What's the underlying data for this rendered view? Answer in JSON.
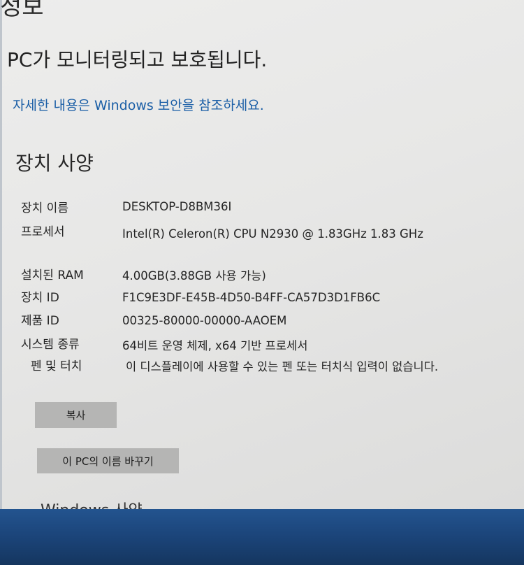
{
  "header": {
    "section_title": "정보"
  },
  "protection": {
    "status_text": "PC가 모니터링되고 보호됩니다.",
    "link_text": "자세한 내용은 Windows 보안을 참조하세요."
  },
  "device_specs": {
    "title": "장치 사양",
    "rows": [
      {
        "label": "장치 이름",
        "value": "DESKTOP-D8BM36I"
      },
      {
        "label": "프로세서",
        "value": "Intel(R) Celeron(R) CPU N2930 @ 1.83GHz 1.83 GHz"
      },
      {
        "label": "설치된 RAM",
        "value": "4.00GB(3.88GB 사용 가능)"
      },
      {
        "label": "장치 ID",
        "value": "F1C9E3DF-E45B-4D50-B4FF-CA57D3D1FB6C"
      },
      {
        "label": "제품 ID",
        "value": "00325-80000-00000-AAOEM"
      },
      {
        "label": "시스템 종류",
        "value": "64비트 운영 체제, x64 기반 프로세서"
      },
      {
        "label": "펜 및 터치",
        "value": "이 디스플레이에 사용할 수 있는 펜 또는 터치식 입력이 없습니다."
      }
    ],
    "copy_button": "복사",
    "rename_button": "이 PC의 이름 바꾸기"
  },
  "next_section": {
    "title": "Windows 사양"
  },
  "colors": {
    "link": "#1a5ea6",
    "button": "#b5b5b4",
    "background": "#e8e8e7",
    "taskbar": "#1c4a83"
  }
}
